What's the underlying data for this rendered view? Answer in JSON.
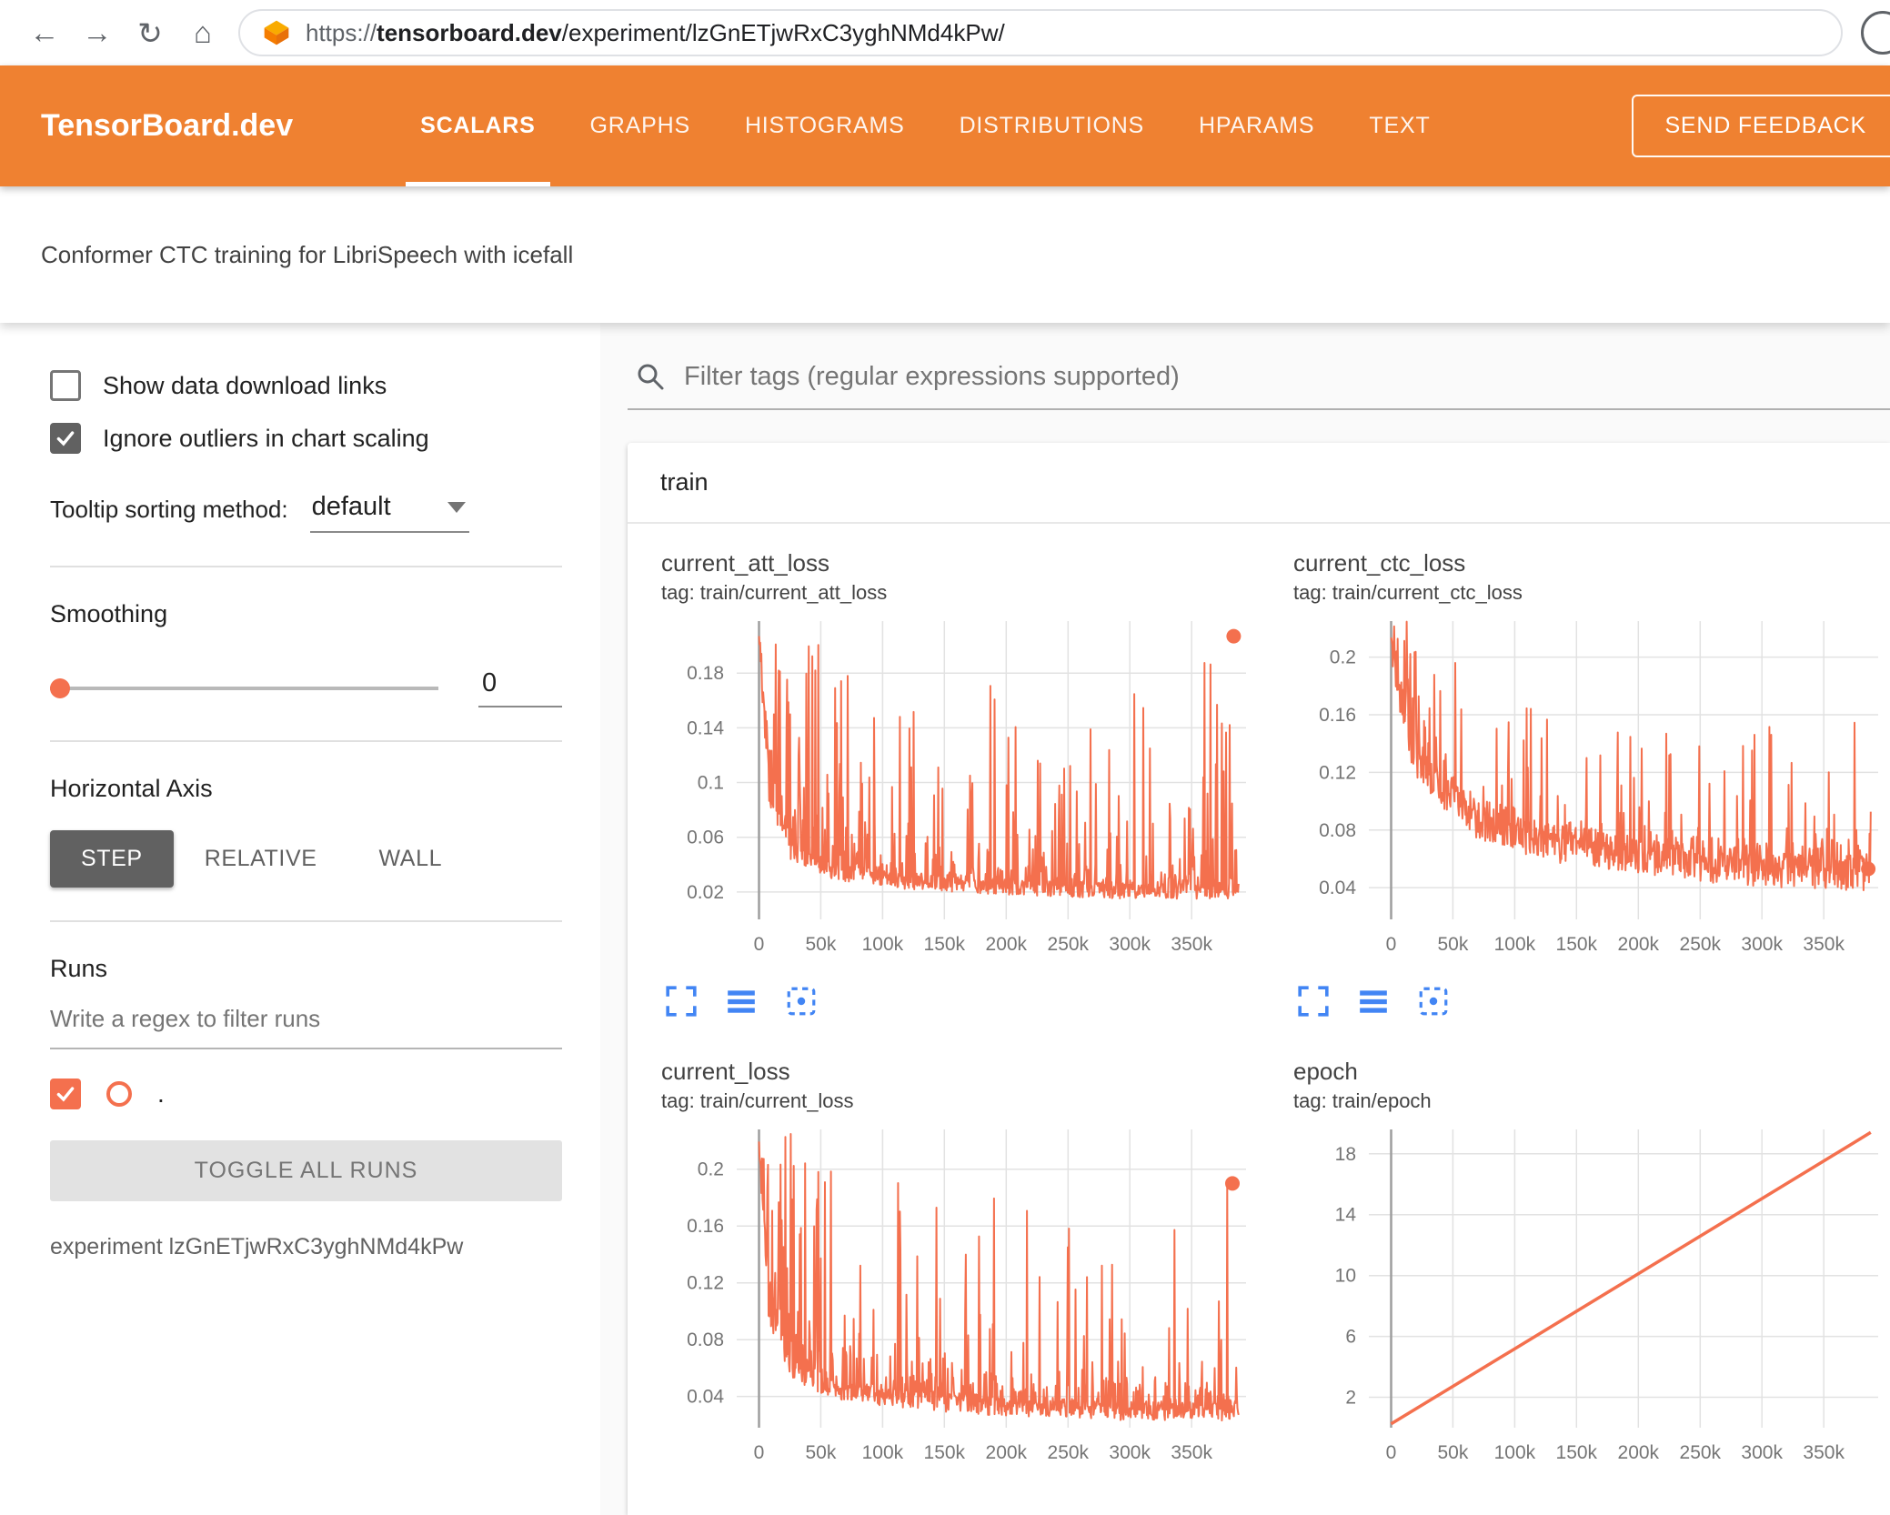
{
  "browser": {
    "url_scheme": "https://",
    "url_domain": "tensorboard.dev",
    "url_path": "/experiment/lzGnETjwRxC3yghNMd4kPw/"
  },
  "header": {
    "logo": "TensorBoard.dev",
    "tabs": [
      {
        "label": "SCALARS",
        "active": true
      },
      {
        "label": "GRAPHS",
        "active": false
      },
      {
        "label": "HISTOGRAMS",
        "active": false
      },
      {
        "label": "DISTRIBUTIONS",
        "active": false
      },
      {
        "label": "HPARAMS",
        "active": false
      },
      {
        "label": "TEXT",
        "active": false
      }
    ],
    "feedback_button": "SEND FEEDBACK"
  },
  "subheader": {
    "experiment_title": "Conformer CTC training for LibriSpeech with icefall"
  },
  "sidebar": {
    "show_download_label": "Show data download links",
    "show_download_checked": false,
    "ignore_outliers_label": "Ignore outliers in chart scaling",
    "ignore_outliers_checked": true,
    "tooltip_sorting_label": "Tooltip sorting method:",
    "tooltip_sorting_value": "default",
    "smoothing_label": "Smoothing",
    "smoothing_value": "0",
    "horizontal_axis_label": "Horizontal Axis",
    "axis_options": [
      "STEP",
      "RELATIVE",
      "WALL"
    ],
    "axis_selected": "STEP",
    "runs_label": "Runs",
    "runs_filter_placeholder": "Write a regex to filter runs",
    "run_name": ".",
    "run_checked": true,
    "toggle_all_label": "TOGGLE ALL RUNS",
    "experiment_caption": "experiment lzGnETjwRxC3yghNMd4kPw"
  },
  "content": {
    "filter_placeholder": "Filter tags (regular expressions supported)",
    "group_title": "train"
  },
  "colors": {
    "header_orange": "#ef8131",
    "run_accent": "#f4704e",
    "tool_icon_blue": "#4285f4",
    "grid_line": "#e2e2e2",
    "zero_line": "#9e9e9e",
    "tick_text": "#757575"
  },
  "icons": [
    "back-icon",
    "forward-icon",
    "reload-icon",
    "home-icon",
    "tensorboard-favicon",
    "avatar",
    "search-icon",
    "dropdown-arrow-icon",
    "slider-thumb",
    "fullscreen-icon",
    "log-scale-icon",
    "fit-domain-icon",
    "checkmark-icon"
  ],
  "chart_data": [
    {
      "title": "current_att_loss",
      "tag": "tag: train/current_att_loss",
      "type": "line",
      "series_color": "#f4704e",
      "line_width": 2,
      "xlim": [
        -18000,
        394000
      ],
      "x_data_max": 388000,
      "x_ticks": [
        0,
        50000,
        100000,
        150000,
        200000,
        250000,
        300000,
        350000
      ],
      "x_tick_labels": [
        "0",
        "50k",
        "100k",
        "150k",
        "200k",
        "250k",
        "300k",
        "350k"
      ],
      "ylim": [
        0,
        0.218
      ],
      "y_ticks": [
        0.02,
        0.06,
        0.1,
        0.14,
        0.18
      ],
      "y_tick_labels": [
        "0.02",
        "0.06",
        "0.1",
        "0.14",
        "0.18"
      ],
      "trend_baseline": [
        [
          0,
          0.205
        ],
        [
          8000,
          0.09
        ],
        [
          25000,
          0.05
        ],
        [
          60000,
          0.035
        ],
        [
          120000,
          0.028
        ],
        [
          200000,
          0.024
        ],
        [
          300000,
          0.021
        ],
        [
          388000,
          0.021
        ]
      ],
      "spike_ceiling": [
        [
          0,
          0.218
        ],
        [
          30000,
          0.218
        ],
        [
          70000,
          0.19
        ],
        [
          150000,
          0.175
        ],
        [
          250000,
          0.165
        ],
        [
          340000,
          0.175
        ],
        [
          388000,
          0.218
        ]
      ],
      "noise": {
        "seed": 13,
        "jitter": 0.006,
        "spike_prob": 0.11,
        "minor_prob": 0.3,
        "minor_scale": 0.12
      },
      "last_point": [
        384000,
        0.207
      ],
      "show_tools": true
    },
    {
      "title": "current_ctc_loss",
      "tag": "tag: train/current_ctc_loss",
      "type": "line",
      "series_color": "#f4704e",
      "line_width": 2,
      "xlim": [
        -18000,
        394000
      ],
      "x_data_max": 388000,
      "x_ticks": [
        0,
        50000,
        100000,
        150000,
        200000,
        250000,
        300000,
        350000
      ],
      "x_tick_labels": [
        "0",
        "50k",
        "100k",
        "150k",
        "200k",
        "250k",
        "300k",
        "350k"
      ],
      "ylim": [
        0.018,
        0.225
      ],
      "y_ticks": [
        0.04,
        0.08,
        0.12,
        0.16,
        0.2
      ],
      "y_tick_labels": [
        "0.04",
        "0.08",
        "0.12",
        "0.16",
        "0.2"
      ],
      "trend_baseline": [
        [
          0,
          0.21
        ],
        [
          12000,
          0.14
        ],
        [
          35000,
          0.105
        ],
        [
          70000,
          0.085
        ],
        [
          130000,
          0.07
        ],
        [
          200000,
          0.06
        ],
        [
          300000,
          0.052
        ],
        [
          388000,
          0.05
        ]
      ],
      "spike_ceiling": [
        [
          0,
          0.225
        ],
        [
          25000,
          0.225
        ],
        [
          70000,
          0.18
        ],
        [
          140000,
          0.155
        ],
        [
          250000,
          0.145
        ],
        [
          388000,
          0.165
        ]
      ],
      "noise": {
        "seed": 29,
        "jitter": 0.012,
        "spike_prob": 0.14,
        "minor_prob": 0.35,
        "minor_scale": 0.15
      },
      "last_point": [
        386000,
        0.053
      ],
      "show_tools": true
    },
    {
      "title": "current_loss",
      "tag": "tag: train/current_loss",
      "type": "line",
      "series_color": "#f4704e",
      "line_width": 2,
      "xlim": [
        -18000,
        394000
      ],
      "x_data_max": 388000,
      "x_ticks": [
        0,
        50000,
        100000,
        150000,
        200000,
        250000,
        300000,
        350000
      ],
      "x_tick_labels": [
        "0",
        "50k",
        "100k",
        "150k",
        "200k",
        "250k",
        "300k",
        "350k"
      ],
      "ylim": [
        0.018,
        0.228
      ],
      "y_ticks": [
        0.04,
        0.08,
        0.12,
        0.16,
        0.2
      ],
      "y_tick_labels": [
        "0.04",
        "0.08",
        "0.12",
        "0.16",
        "0.2"
      ],
      "trend_baseline": [
        [
          0,
          0.215
        ],
        [
          8000,
          0.1
        ],
        [
          25000,
          0.06
        ],
        [
          60000,
          0.045
        ],
        [
          120000,
          0.038
        ],
        [
          200000,
          0.033
        ],
        [
          300000,
          0.03
        ],
        [
          388000,
          0.03
        ]
      ],
      "spike_ceiling": [
        [
          0,
          0.228
        ],
        [
          30000,
          0.228
        ],
        [
          80000,
          0.2
        ],
        [
          150000,
          0.185
        ],
        [
          250000,
          0.175
        ],
        [
          340000,
          0.19
        ],
        [
          388000,
          0.2
        ]
      ],
      "noise": {
        "seed": 47,
        "jitter": 0.007,
        "spike_prob": 0.11,
        "minor_prob": 0.3,
        "minor_scale": 0.12
      },
      "last_point": [
        383000,
        0.19
      ],
      "show_tools": false
    },
    {
      "title": "epoch",
      "tag": "tag: train/epoch",
      "type": "line",
      "series_color": "#f4704e",
      "line_width": 3.5,
      "xlim": [
        -18000,
        394000
      ],
      "x_data_max": 388000,
      "x_ticks": [
        0,
        50000,
        100000,
        150000,
        200000,
        250000,
        300000,
        350000
      ],
      "x_tick_labels": [
        "0",
        "50k",
        "100k",
        "150k",
        "200k",
        "250k",
        "300k",
        "350k"
      ],
      "ylim": [
        0,
        19.6
      ],
      "y_ticks": [
        2,
        6,
        10,
        14,
        18
      ],
      "y_tick_labels": [
        "2",
        "6",
        "10",
        "14",
        "18"
      ],
      "trend_baseline": [
        [
          0,
          0.25
        ],
        [
          388000,
          19.4
        ]
      ],
      "spike_ceiling": [
        [
          0,
          0.25
        ],
        [
          388000,
          19.4
        ]
      ],
      "noise": {
        "seed": 1,
        "jitter": 0,
        "spike_prob": 0,
        "minor_prob": 0,
        "minor_scale": 0
      },
      "last_point": null,
      "show_tools": false
    }
  ]
}
